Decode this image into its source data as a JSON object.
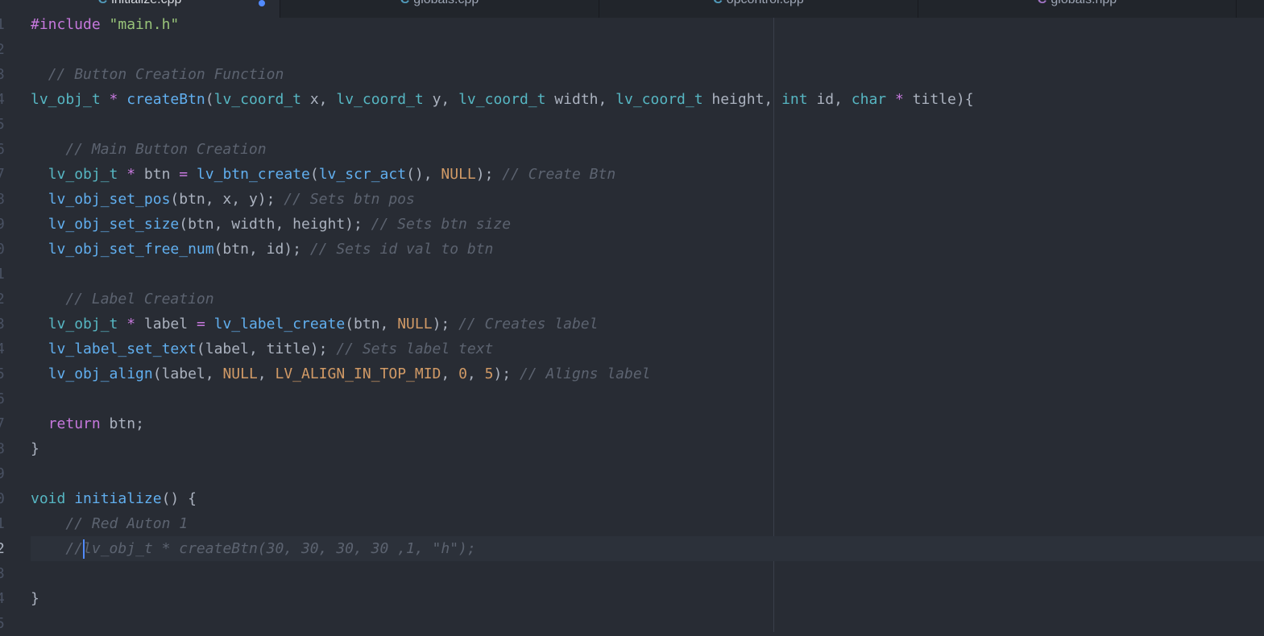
{
  "tabs": [
    {
      "label": "initialize.cpp",
      "icon": "c-file-icon",
      "active": true,
      "modified": true
    },
    {
      "label": "globals.cpp",
      "icon": "c-file-icon",
      "active": false,
      "modified": false
    },
    {
      "label": "opcontrol.cpp",
      "icon": "c-file-icon",
      "active": false,
      "modified": false
    },
    {
      "label": "globals.hpp",
      "icon": "c-header-icon",
      "active": false,
      "modified": false
    }
  ],
  "tab_icon_glyph": "C",
  "cursor_line": 22,
  "gutter": [
    "1",
    "2",
    "3",
    "4",
    "5",
    "6",
    "7",
    "8",
    "9",
    "0",
    "1",
    "2",
    "3",
    "4",
    "5",
    "6",
    "7",
    "8",
    "9",
    "0",
    "1",
    "2",
    "3",
    "4",
    "5"
  ],
  "lines": [
    [
      [
        "kw",
        "#include "
      ],
      [
        "str",
        "\"main.h\""
      ]
    ],
    [],
    [
      [
        "plain",
        "  "
      ],
      [
        "com",
        "// Button Creation Function"
      ]
    ],
    [
      [
        "type",
        "lv_obj_t"
      ],
      [
        "plain",
        " "
      ],
      [
        "op",
        "*"
      ],
      [
        "plain",
        " "
      ],
      [
        "fn",
        "createBtn"
      ],
      [
        "plain",
        "("
      ],
      [
        "type",
        "lv_coord_t"
      ],
      [
        "plain",
        " x, "
      ],
      [
        "type",
        "lv_coord_t"
      ],
      [
        "plain",
        " y, "
      ],
      [
        "type",
        "lv_coord_t"
      ],
      [
        "plain",
        " width, "
      ],
      [
        "type",
        "lv_coord_t"
      ],
      [
        "plain",
        " height, "
      ],
      [
        "type",
        "int"
      ],
      [
        "plain",
        " id, "
      ],
      [
        "type",
        "char"
      ],
      [
        "plain",
        " "
      ],
      [
        "op",
        "*"
      ],
      [
        "plain",
        " title){"
      ]
    ],
    [],
    [
      [
        "plain",
        "    "
      ],
      [
        "com",
        "// Main Button Creation"
      ]
    ],
    [
      [
        "plain",
        "  "
      ],
      [
        "type",
        "lv_obj_t"
      ],
      [
        "plain",
        " "
      ],
      [
        "op",
        "*"
      ],
      [
        "plain",
        " btn "
      ],
      [
        "op",
        "="
      ],
      [
        "plain",
        " "
      ],
      [
        "fn",
        "lv_btn_create"
      ],
      [
        "plain",
        "("
      ],
      [
        "fn",
        "lv_scr_act"
      ],
      [
        "plain",
        "(), "
      ],
      [
        "const",
        "NULL"
      ],
      [
        "plain",
        "); "
      ],
      [
        "com",
        "// Create Btn"
      ]
    ],
    [
      [
        "plain",
        "  "
      ],
      [
        "fn",
        "lv_obj_set_pos"
      ],
      [
        "plain",
        "(btn, x, y); "
      ],
      [
        "com",
        "// Sets btn pos"
      ]
    ],
    [
      [
        "plain",
        "  "
      ],
      [
        "fn",
        "lv_obj_set_size"
      ],
      [
        "plain",
        "(btn, width, height); "
      ],
      [
        "com",
        "// Sets btn size"
      ]
    ],
    [
      [
        "plain",
        "  "
      ],
      [
        "fn",
        "lv_obj_set_free_num"
      ],
      [
        "plain",
        "(btn, id); "
      ],
      [
        "com",
        "// Sets id val to btn"
      ]
    ],
    [],
    [
      [
        "plain",
        "    "
      ],
      [
        "com",
        "// Label Creation"
      ]
    ],
    [
      [
        "plain",
        "  "
      ],
      [
        "type",
        "lv_obj_t"
      ],
      [
        "plain",
        " "
      ],
      [
        "op",
        "*"
      ],
      [
        "plain",
        " label "
      ],
      [
        "op",
        "="
      ],
      [
        "plain",
        " "
      ],
      [
        "fn",
        "lv_label_create"
      ],
      [
        "plain",
        "(btn, "
      ],
      [
        "const",
        "NULL"
      ],
      [
        "plain",
        "); "
      ],
      [
        "com",
        "// Creates label"
      ]
    ],
    [
      [
        "plain",
        "  "
      ],
      [
        "fn",
        "lv_label_set_text"
      ],
      [
        "plain",
        "(label, title); "
      ],
      [
        "com",
        "// Sets label text"
      ]
    ],
    [
      [
        "plain",
        "  "
      ],
      [
        "fn",
        "lv_obj_align"
      ],
      [
        "plain",
        "(label, "
      ],
      [
        "const",
        "NULL"
      ],
      [
        "plain",
        ", "
      ],
      [
        "const",
        "LV_ALIGN_IN_TOP_MID"
      ],
      [
        "plain",
        ", "
      ],
      [
        "num",
        "0"
      ],
      [
        "plain",
        ", "
      ],
      [
        "num",
        "5"
      ],
      [
        "plain",
        "); "
      ],
      [
        "com",
        "// Aligns label"
      ]
    ],
    [],
    [
      [
        "plain",
        "  "
      ],
      [
        "kw",
        "return"
      ],
      [
        "plain",
        " btn;"
      ]
    ],
    [
      [
        "plain",
        "}"
      ]
    ],
    [],
    [
      [
        "type",
        "void"
      ],
      [
        "plain",
        " "
      ],
      [
        "fn",
        "initialize"
      ],
      [
        "plain",
        "() {"
      ]
    ],
    [
      [
        "plain",
        "    "
      ],
      [
        "com",
        "// Red Auton 1"
      ]
    ],
    [
      [
        "plain",
        "    "
      ],
      [
        "com",
        "//"
      ],
      [
        "caret",
        ""
      ],
      [
        "com",
        "lv_obj_t * createBtn(30, 30, 30, 30 ,1, \"h\");"
      ]
    ],
    [],
    [
      [
        "plain",
        "}"
      ]
    ],
    []
  ]
}
